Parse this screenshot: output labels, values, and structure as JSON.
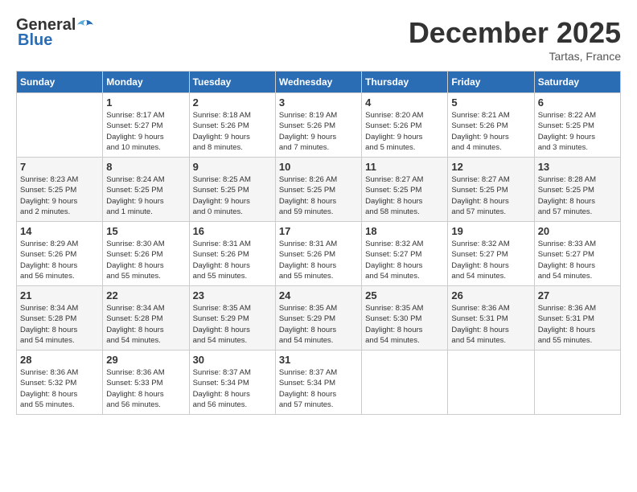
{
  "logo": {
    "general": "General",
    "blue": "Blue"
  },
  "title": "December 2025",
  "location": "Tartas, France",
  "weekdays": [
    "Sunday",
    "Monday",
    "Tuesday",
    "Wednesday",
    "Thursday",
    "Friday",
    "Saturday"
  ],
  "weeks": [
    [
      {
        "day": "",
        "info": ""
      },
      {
        "day": "1",
        "info": "Sunrise: 8:17 AM\nSunset: 5:27 PM\nDaylight: 9 hours\nand 10 minutes."
      },
      {
        "day": "2",
        "info": "Sunrise: 8:18 AM\nSunset: 5:26 PM\nDaylight: 9 hours\nand 8 minutes."
      },
      {
        "day": "3",
        "info": "Sunrise: 8:19 AM\nSunset: 5:26 PM\nDaylight: 9 hours\nand 7 minutes."
      },
      {
        "day": "4",
        "info": "Sunrise: 8:20 AM\nSunset: 5:26 PM\nDaylight: 9 hours\nand 5 minutes."
      },
      {
        "day": "5",
        "info": "Sunrise: 8:21 AM\nSunset: 5:26 PM\nDaylight: 9 hours\nand 4 minutes."
      },
      {
        "day": "6",
        "info": "Sunrise: 8:22 AM\nSunset: 5:25 PM\nDaylight: 9 hours\nand 3 minutes."
      }
    ],
    [
      {
        "day": "7",
        "info": "Sunrise: 8:23 AM\nSunset: 5:25 PM\nDaylight: 9 hours\nand 2 minutes."
      },
      {
        "day": "8",
        "info": "Sunrise: 8:24 AM\nSunset: 5:25 PM\nDaylight: 9 hours\nand 1 minute."
      },
      {
        "day": "9",
        "info": "Sunrise: 8:25 AM\nSunset: 5:25 PM\nDaylight: 9 hours\nand 0 minutes."
      },
      {
        "day": "10",
        "info": "Sunrise: 8:26 AM\nSunset: 5:25 PM\nDaylight: 8 hours\nand 59 minutes."
      },
      {
        "day": "11",
        "info": "Sunrise: 8:27 AM\nSunset: 5:25 PM\nDaylight: 8 hours\nand 58 minutes."
      },
      {
        "day": "12",
        "info": "Sunrise: 8:27 AM\nSunset: 5:25 PM\nDaylight: 8 hours\nand 57 minutes."
      },
      {
        "day": "13",
        "info": "Sunrise: 8:28 AM\nSunset: 5:25 PM\nDaylight: 8 hours\nand 57 minutes."
      }
    ],
    [
      {
        "day": "14",
        "info": "Sunrise: 8:29 AM\nSunset: 5:26 PM\nDaylight: 8 hours\nand 56 minutes."
      },
      {
        "day": "15",
        "info": "Sunrise: 8:30 AM\nSunset: 5:26 PM\nDaylight: 8 hours\nand 55 minutes."
      },
      {
        "day": "16",
        "info": "Sunrise: 8:31 AM\nSunset: 5:26 PM\nDaylight: 8 hours\nand 55 minutes."
      },
      {
        "day": "17",
        "info": "Sunrise: 8:31 AM\nSunset: 5:26 PM\nDaylight: 8 hours\nand 55 minutes."
      },
      {
        "day": "18",
        "info": "Sunrise: 8:32 AM\nSunset: 5:27 PM\nDaylight: 8 hours\nand 54 minutes."
      },
      {
        "day": "19",
        "info": "Sunrise: 8:32 AM\nSunset: 5:27 PM\nDaylight: 8 hours\nand 54 minutes."
      },
      {
        "day": "20",
        "info": "Sunrise: 8:33 AM\nSunset: 5:27 PM\nDaylight: 8 hours\nand 54 minutes."
      }
    ],
    [
      {
        "day": "21",
        "info": "Sunrise: 8:34 AM\nSunset: 5:28 PM\nDaylight: 8 hours\nand 54 minutes."
      },
      {
        "day": "22",
        "info": "Sunrise: 8:34 AM\nSunset: 5:28 PM\nDaylight: 8 hours\nand 54 minutes."
      },
      {
        "day": "23",
        "info": "Sunrise: 8:35 AM\nSunset: 5:29 PM\nDaylight: 8 hours\nand 54 minutes."
      },
      {
        "day": "24",
        "info": "Sunrise: 8:35 AM\nSunset: 5:29 PM\nDaylight: 8 hours\nand 54 minutes."
      },
      {
        "day": "25",
        "info": "Sunrise: 8:35 AM\nSunset: 5:30 PM\nDaylight: 8 hours\nand 54 minutes."
      },
      {
        "day": "26",
        "info": "Sunrise: 8:36 AM\nSunset: 5:31 PM\nDaylight: 8 hours\nand 54 minutes."
      },
      {
        "day": "27",
        "info": "Sunrise: 8:36 AM\nSunset: 5:31 PM\nDaylight: 8 hours\nand 55 minutes."
      }
    ],
    [
      {
        "day": "28",
        "info": "Sunrise: 8:36 AM\nSunset: 5:32 PM\nDaylight: 8 hours\nand 55 minutes."
      },
      {
        "day": "29",
        "info": "Sunrise: 8:36 AM\nSunset: 5:33 PM\nDaylight: 8 hours\nand 56 minutes."
      },
      {
        "day": "30",
        "info": "Sunrise: 8:37 AM\nSunset: 5:34 PM\nDaylight: 8 hours\nand 56 minutes."
      },
      {
        "day": "31",
        "info": "Sunrise: 8:37 AM\nSunset: 5:34 PM\nDaylight: 8 hours\nand 57 minutes."
      },
      {
        "day": "",
        "info": ""
      },
      {
        "day": "",
        "info": ""
      },
      {
        "day": "",
        "info": ""
      }
    ]
  ]
}
